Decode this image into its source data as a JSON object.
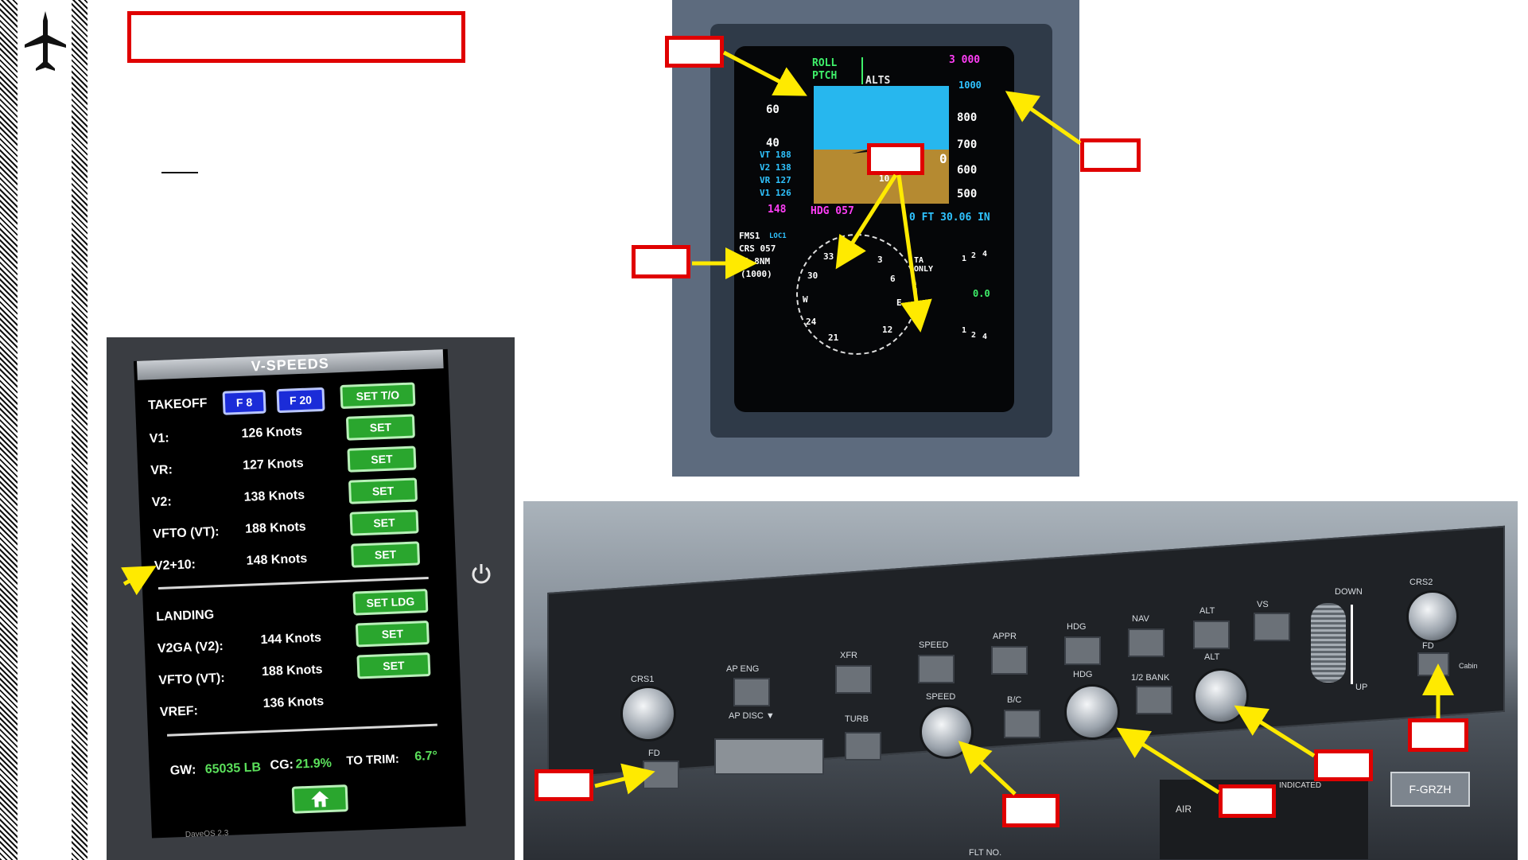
{
  "sidebar": {
    "icon": "airplane-icon"
  },
  "title_box": "",
  "underline_text": "",
  "tablet": {
    "header": "V-SPEEDS",
    "takeoff_label": "TAKEOFF",
    "flap_buttons": [
      "F 8",
      "F 20"
    ],
    "set_to_label": "SET T/O",
    "takeoff_rows": [
      {
        "label": "V1:",
        "value": "126 Knots",
        "button": "SET"
      },
      {
        "label": "VR:",
        "value": "127 Knots",
        "button": "SET"
      },
      {
        "label": "V2:",
        "value": "138 Knots",
        "button": "SET"
      },
      {
        "label": "VFTO (VT):",
        "value": "188 Knots",
        "button": "SET"
      },
      {
        "label": "V2+10:",
        "value": "148 Knots",
        "button": "SET"
      }
    ],
    "landing_label": "LANDING",
    "set_ldg_label": "SET LDG",
    "landing_rows": [
      {
        "label": "V2GA (V2):",
        "value": "144 Knots",
        "button": "SET"
      },
      {
        "label": "VFTO (VT):",
        "value": "188 Knots",
        "button": "SET"
      },
      {
        "label": "VREF:",
        "value": "136 Knots",
        "button": ""
      }
    ],
    "gw_label": "GW:",
    "gw_value": "65035 LB",
    "cg_label": "CG:",
    "cg_value": "21.9%",
    "trim_label": "TO TRIM:",
    "trim_value": "6.7°",
    "footer": "DaveOS 2.3",
    "home_icon": "home-icon",
    "power_icon": "power-icon"
  },
  "pfd": {
    "mode_roll": "ROLL",
    "mode_pitch": "PTCH",
    "mode_alts": "ALTS",
    "alt_target": "3 000",
    "alt_scale": [
      "1000",
      "800",
      "700",
      "600",
      "500"
    ],
    "alt_current": "0",
    "speed_scale": [
      "60",
      "40"
    ],
    "vspeeds": [
      "VT 188",
      "V2 138",
      "VR 127",
      "V1 126"
    ],
    "speed_bug": "148",
    "heading": "HDG 057",
    "pitch_marks": [
      "10",
      "10"
    ],
    "baro": "0 FT 30.06 IN",
    "nav_source": "FMS1",
    "nav_mode": "LOC1",
    "course": "CRS 057",
    "distance": "0.8NM",
    "distance_alt": "(1000)",
    "tcas": "TA ONLY",
    "compass_labels": [
      "N",
      "33",
      "30",
      "W",
      "24",
      "21",
      "3",
      "6",
      "E",
      "12"
    ],
    "vs_value": "0.0",
    "vs_scale": [
      "1",
      "2",
      "4",
      "1",
      "2",
      "4"
    ]
  },
  "fcp": {
    "labels": {
      "crs1": "CRS1",
      "fd": "FD",
      "ap_eng": "AP  ENG",
      "ap_disc": "AP  DISC ▼",
      "xfr": "XFR",
      "turb": "TURB",
      "speed_top": "SPEED",
      "speed_knob": "SPEED",
      "appr": "APPR",
      "bc": "B/C",
      "hdg_top": "HDG",
      "hdg_knob": "HDG",
      "nav": "NAV",
      "half_bank": "1/2 BANK",
      "alt_top": "ALT",
      "alt_knob": "ALT",
      "vs": "VS",
      "down": "DOWN",
      "up": "UP",
      "crs2": "CRS2",
      "fd2": "FD",
      "cabin": "Cabin"
    },
    "tail_placard": "F-GRZH",
    "speed_card_header": "INDICATED",
    "speed_card_title": "AIR",
    "speed_card_sub": "FLT NO."
  },
  "callouts": [
    "",
    "",
    "",
    "",
    "",
    "",
    "",
    "",
    ""
  ]
}
